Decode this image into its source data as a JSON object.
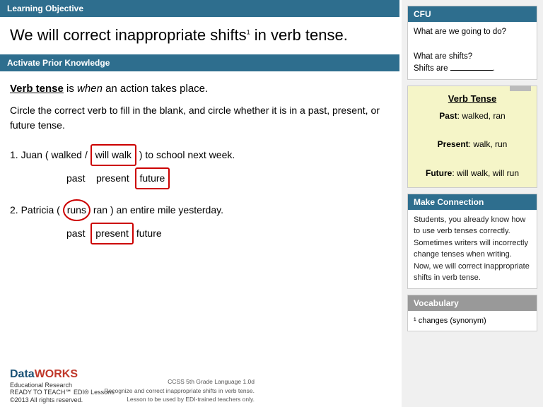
{
  "learning_objective_banner": "Learning Objective",
  "main_heading": "We will correct inappropriate shifts",
  "main_heading_sup": "1",
  "main_heading_suffix": " in verb tense.",
  "apk_banner": "Activate Prior Knowledge",
  "verb_tense_intro": {
    "bold_underline": "Verb tense",
    "rest": " is ",
    "italic": "when",
    "end": " an action takes place."
  },
  "instruction": "Circle the correct verb to fill in the blank, and circle whether it is in a past, present, or future tense.",
  "exercises": [
    {
      "number": "1.",
      "pre": "Juan ( walked /",
      "answer": "will walk",
      "post": ") to school next week.",
      "tense_line": {
        "past": "past",
        "present": "present",
        "future": "future",
        "correct": "future"
      }
    },
    {
      "number": "2.",
      "pre": "Patricia (",
      "circled": "runs",
      "mid": "ran ) an entire mile yesterday.",
      "tense_line": {
        "past": "past",
        "present": "present",
        "future": "future",
        "correct": "present"
      }
    }
  ],
  "sidebar": {
    "cfu": {
      "header": "CFU",
      "line1": "What are we going to do?",
      "line2": "What are shifts?",
      "line3": "Shifts are ___________."
    },
    "verb_tense_card": {
      "title": "Verb Tense",
      "past_label": "Past",
      "past_value": ": walked, ran",
      "present_label": "Present",
      "present_value": ": walk, run",
      "future_label": "Future",
      "future_value": ": will walk, will run"
    },
    "make_connection": {
      "header": "Make Connection",
      "body": "Students, you already know how to use verb tenses correctly. Sometimes writers will incorrectly change tenses when writing. Now, we will correct inappropriate shifts in verb tense."
    },
    "vocabulary": {
      "header": "Vocabulary",
      "body": "¹ changes (synonym)"
    }
  },
  "footer": {
    "logo": {
      "data": "Data",
      "works": "WORKS",
      "sub1": "Educational Research",
      "sub2": "READY TO TEACH℠ EDI® Lessons",
      "sub3": "©2013 All rights reserved."
    },
    "copyright": {
      "line1": "CCSS 5th Grade Language 1.0d",
      "line2": "Recognize and correct inappropriate shifts in verb tense.",
      "line3": "Lesson to be used by EDI-trained teachers only."
    }
  }
}
